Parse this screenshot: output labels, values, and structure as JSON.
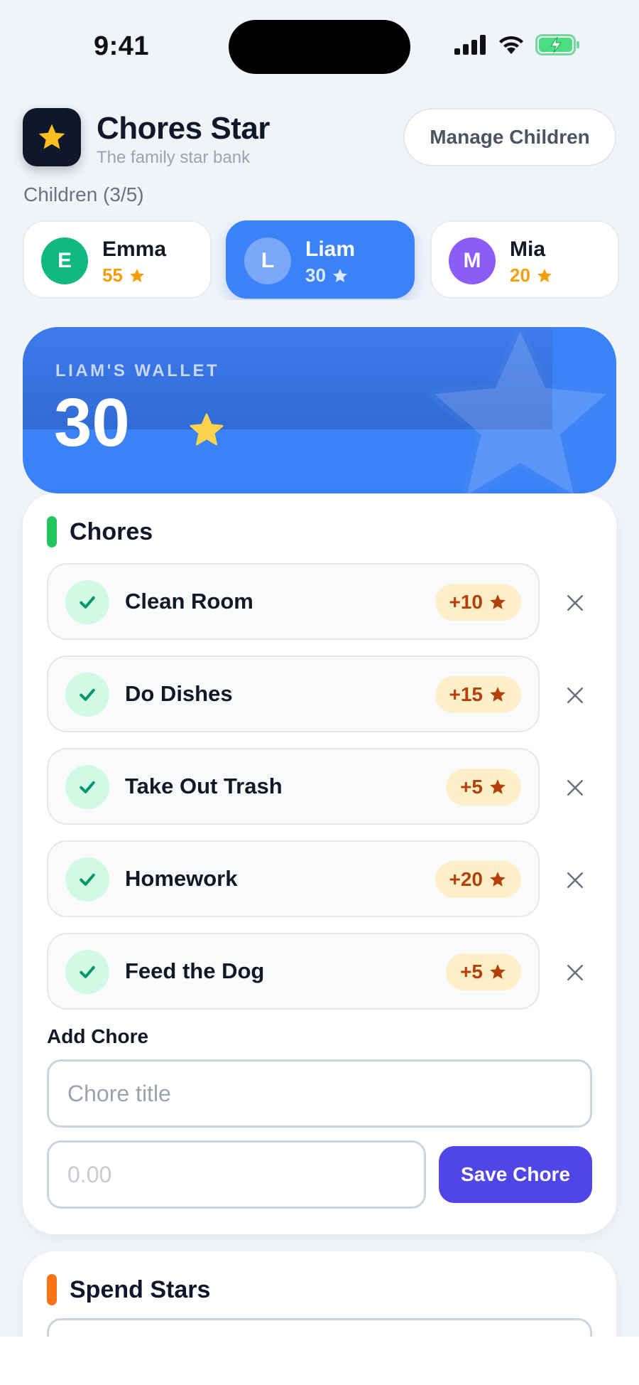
{
  "status_bar": {
    "time": "9:41"
  },
  "header": {
    "title": "Chores Star",
    "subtitle": "The family star bank",
    "manage_label": "Manage Children"
  },
  "children_label": "Children (3/5)",
  "children": [
    {
      "initial": "E",
      "name": "Emma",
      "stars": "55",
      "color": "#10b981",
      "active": false
    },
    {
      "initial": "L",
      "name": "Liam",
      "stars": "30",
      "color": "#7aa8f8",
      "active": true
    },
    {
      "initial": "M",
      "name": "Mia",
      "stars": "20",
      "color": "#8b5cf6",
      "active": false
    }
  ],
  "wallet": {
    "label": "LIAM'S WALLET",
    "amount": "30"
  },
  "chores": {
    "title": "Chores",
    "items": [
      {
        "title": "Clean Room",
        "reward": "+10"
      },
      {
        "title": "Do Dishes",
        "reward": "+15"
      },
      {
        "title": "Take Out Trash",
        "reward": "+5"
      },
      {
        "title": "Homework",
        "reward": "+20"
      },
      {
        "title": "Feed the Dog",
        "reward": "+5"
      }
    ],
    "add_label": "Add Chore",
    "title_placeholder": "Chore title",
    "points_placeholder": "0.00",
    "save_label": "Save Chore"
  },
  "spend": {
    "title": "Spend Stars"
  },
  "colors": {
    "primary": "#3b82f6",
    "accent": "#4f46e5",
    "chores_bar": "#22c55e",
    "spend_bar": "#f97316",
    "star": "#f59e0b"
  }
}
